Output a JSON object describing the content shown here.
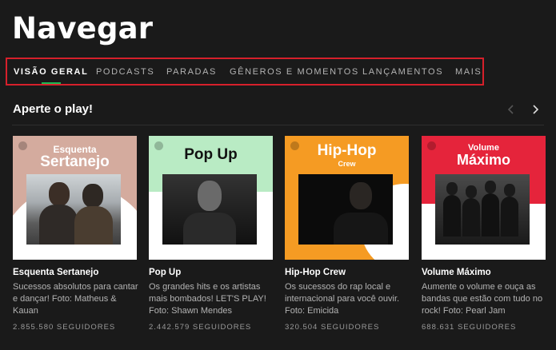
{
  "page": {
    "title": "Navegar"
  },
  "tabs": [
    {
      "label": "VISÃO GERAL",
      "active": true
    },
    {
      "label": "PODCASTS"
    },
    {
      "label": "PARADAS"
    },
    {
      "label": "GÊNEROS E MOMENTOS"
    },
    {
      "label": "LANÇAMENTOS"
    },
    {
      "label": "MAIS"
    }
  ],
  "section": {
    "title": "Aperte o play!",
    "prev_icon": "chevron-left-icon",
    "next_icon": "chevron-right-icon"
  },
  "colors": {
    "highlight_border": "#d6202b",
    "active_underline": "#1db954"
  },
  "playlists": [
    {
      "cover_line1": "Esquenta",
      "cover_line2": "Sertanejo",
      "cover_color": "#d4ab9e",
      "name": "Esquenta Sertanejo",
      "description": "Sucessos absolutos para cantar e dançar! Foto: Matheus & Kauan",
      "followers": "2.855.580 SEGUIDORES"
    },
    {
      "cover_line1": "Pop Up",
      "cover_line2": "",
      "cover_color": "#b9ebc4",
      "name": "Pop Up",
      "description": "Os grandes hits e os artistas mais bombados! LET'S PLAY! Foto: Shawn Mendes",
      "followers": "2.442.579 SEGUIDORES"
    },
    {
      "cover_line1": "Hip-Hop",
      "cover_line2": "Crew",
      "cover_color": "#f59b23",
      "name": "Hip-Hop Crew",
      "description": "Os sucessos do rap local e internacional para você ouvir. Foto: Emicida",
      "followers": "320.504 SEGUIDORES"
    },
    {
      "cover_line1": "Volume",
      "cover_line2": "Máximo",
      "cover_color": "#e5243b",
      "name": "Volume Máximo",
      "description": "Aumente o volume e ouça as bandas que estão com tudo no rock! Foto: Pearl Jam",
      "followers": "688.631 SEGUIDORES"
    }
  ]
}
